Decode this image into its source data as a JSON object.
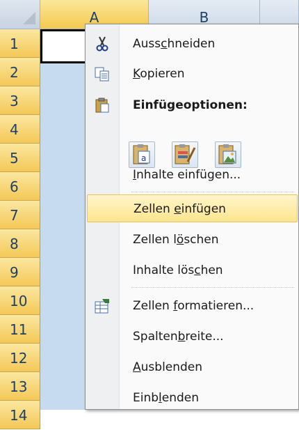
{
  "columns": [
    "A",
    "B"
  ],
  "rows": [
    "1",
    "2",
    "3",
    "4",
    "5",
    "6",
    "7",
    "8",
    "9",
    "10",
    "11",
    "12",
    "13",
    "14"
  ],
  "menu": {
    "items": [
      {
        "id": "cut",
        "pre": "Auss",
        "u": "c",
        "post": "hneiden",
        "icon": "scissors-icon"
      },
      {
        "id": "copy",
        "pre": "",
        "u": "K",
        "post": "opieren",
        "icon": "copy-icon"
      },
      {
        "id": "paste-options",
        "pre": "Einfügeoptionen:",
        "u": "",
        "post": "",
        "icon": "clipboard-icon"
      },
      {
        "id": "paste-special",
        "pre": "",
        "u": "I",
        "post": "nhalte einfügen...",
        "icon": ""
      },
      {
        "id": "insert-cells",
        "pre": "Zellen ",
        "u": "e",
        "post": "infügen",
        "icon": ""
      },
      {
        "id": "delete-cells",
        "pre": "Zellen l",
        "u": "ö",
        "post": "schen",
        "icon": ""
      },
      {
        "id": "clear-contents",
        "pre": "Inhalte lös",
        "u": "c",
        "post": "hen",
        "icon": ""
      },
      {
        "id": "format-cells",
        "pre": "Zellen ",
        "u": "f",
        "post": "ormatieren...",
        "icon": "format-cells-icon"
      },
      {
        "id": "column-width",
        "pre": "Spalten",
        "u": "b",
        "post": "reite...",
        "icon": ""
      },
      {
        "id": "hide",
        "pre": "",
        "u": "A",
        "post": "usblenden",
        "icon": ""
      },
      {
        "id": "unhide",
        "pre": "Einb",
        "u": "l",
        "post": "enden",
        "icon": ""
      }
    ],
    "paste_buttons": [
      "paste-values-icon",
      "paste-formatting-icon",
      "paste-picture-icon"
    ]
  },
  "colors": {
    "selected_header": "#f5c84f",
    "selection": "#c6dbef",
    "hover": "#fde58f"
  }
}
